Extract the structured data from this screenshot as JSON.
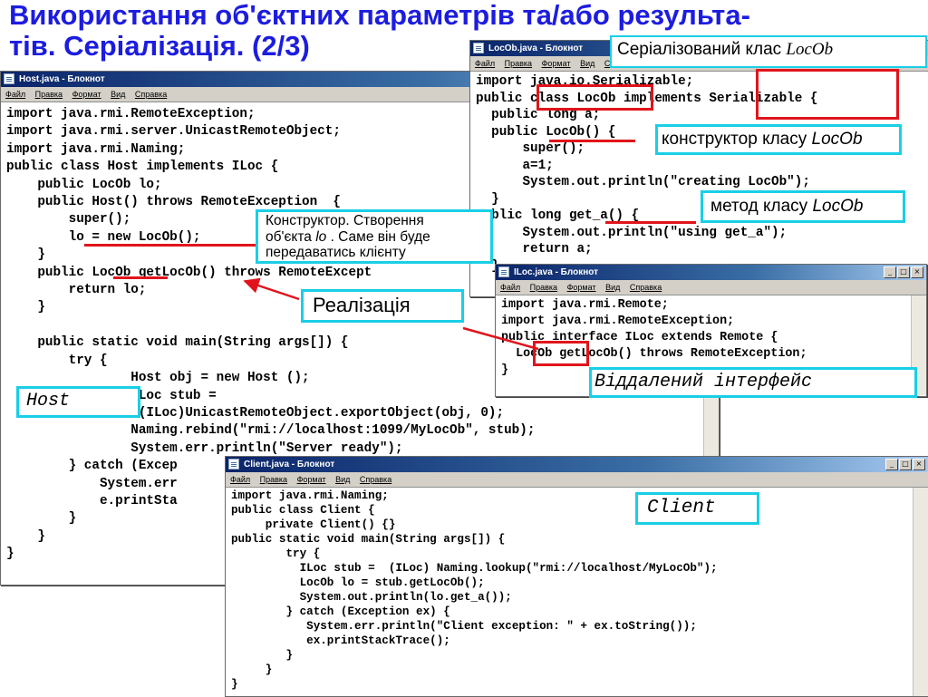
{
  "slide": {
    "title": "Використання об'єктних параметрів та/або результа-\nтів. Серіалізація. (2/3)"
  },
  "windows": {
    "host": {
      "title": "Host.java - Блокнот",
      "menu": [
        "Файл",
        "Правка",
        "Формат",
        "Вид",
        "Справка"
      ],
      "code": "import java.rmi.RemoteException;\nimport java.rmi.server.UnicastRemoteObject;\nimport java.rmi.Naming;\npublic class Host implements ILoc {\n    public LocOb lo;\n    public Host() throws RemoteException  {\n        super();\n        lo = new LocOb();\n    }\n    public LocOb getLocOb() throws RemoteExcept\n        return lo;\n    }\n\n    public static void main(String args[]) {\n        try {\n                Host obj = new Host ();\n                ILoc stub =\n                 (ILoc)UnicastRemoteObject.exportObject(obj, 0);\n                Naming.rebind(\"rmi://localhost:1099/MyLocOb\", stub);\n                System.err.println(\"Server ready\");\n        } catch (Excep\n            System.err\n            e.printSta\n        }\n    }\n}"
    },
    "locob": {
      "title": "LocOb.java - Блокнот",
      "menu": [
        "Файл",
        "Правка",
        "Формат",
        "Вид",
        "Спр"
      ],
      "code": "import java.io.Serializable;\npublic class LocOb implements Serializable {\n  public long a;\n  public LocOb() {\n      super();\n      a=1;\n      System.out.println(\"creating LocOb\");\n  }\npublic long get_a() {\n      System.out.println(\"using get_a\");\n      return a;\n  }"
    },
    "iloc": {
      "title": "ILoc.java - Блокнот",
      "menu": [
        "Файл",
        "Правка",
        "Формат",
        "Вид",
        "Справка"
      ],
      "code": "import java.rmi.Remote;\nimport java.rmi.RemoteException;\npublic interface ILoc extends Remote {\n  LocOb getLocOb() throws RemoteException;\n}"
    },
    "client": {
      "title": "Client.java - Блокнот",
      "menu": [
        "Файл",
        "Правка",
        "Формат",
        "Вид",
        "Справка"
      ],
      "code": "import java.rmi.Naming;\npublic class Client {\n     private Client() {}\npublic static void main(String args[]) {\n        try {\n          ILoc stub =  (ILoc) Naming.lookup(\"rmi://localhost/MyLocOb\");\n          LocOb lo = stub.getLocOb();\n          System.out.println(lo.get_a());\n        } catch (Exception ex) {\n           System.err.println(\"Client exception: \" + ex.toString());\n           ex.printStackTrace();\n        }\n     }\n}"
    }
  },
  "callouts": {
    "serialized_class_prefix": "Серіалізований клас ",
    "serialized_class_name": "LocOb",
    "constructor_prefix": "конструктор класу ",
    "constructor_name": "LocOb",
    "method_prefix": "метод класу ",
    "method_name": "LocOb",
    "lo_line1": "Конструктор.  Створення",
    "lo_line2_pre": "об'єкта ",
    "lo_line2_var": "lo",
    "lo_line2_post": " . Саме він буде",
    "lo_line3": "передаватись клієнту",
    "realization": "Реалізація",
    "remote_interface": "Віддалений інтерфейс",
    "host": "Host",
    "client": "Client"
  },
  "window_controls": {
    "minimize": "_",
    "maximize": "□",
    "close": "×"
  },
  "colors": {
    "title": "#1c1ce0",
    "highlight": "#e0141c",
    "callout_border": "#19cfe6",
    "titlebar": "#0a246a",
    "menubar": "#d4d0c8"
  }
}
